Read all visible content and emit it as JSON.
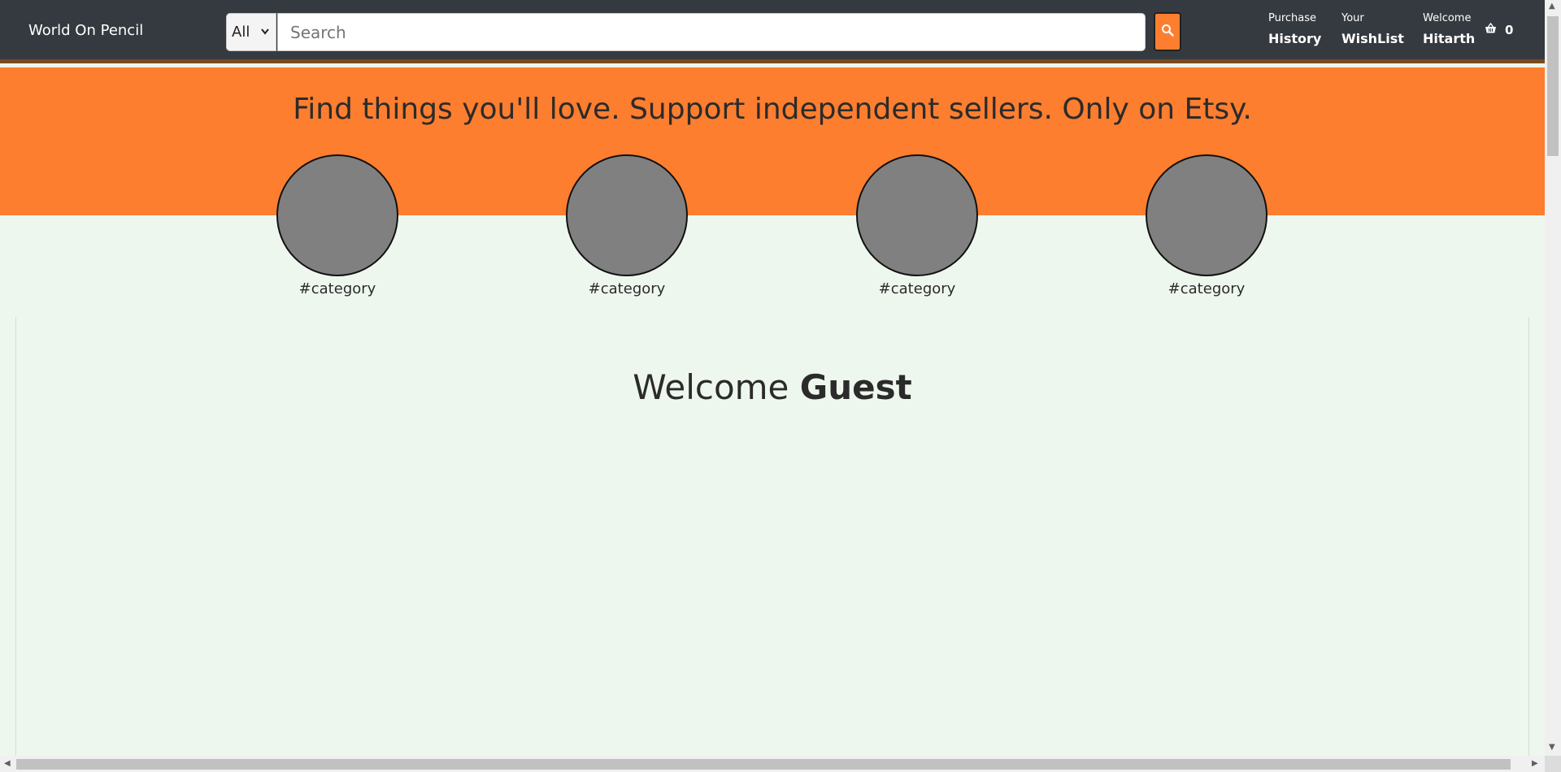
{
  "navbar": {
    "brand": "World On Pencil",
    "category_select": "All",
    "search_placeholder": "Search",
    "links": [
      {
        "small": "Purchase",
        "big": "History"
      },
      {
        "small": "Your",
        "big": "WishList"
      },
      {
        "small": "Welcome",
        "big": "Hitarth"
      }
    ],
    "cart_count": "0"
  },
  "hero": {
    "tagline": "Find things you'll love. Support independent sellers. Only on Etsy."
  },
  "categories": [
    {
      "label": "#category"
    },
    {
      "label": "#category"
    },
    {
      "label": "#category"
    },
    {
      "label": "#category"
    }
  ],
  "main": {
    "welcome_prefix": "Welcome",
    "welcome_name": "Guest"
  },
  "colors": {
    "navbar_bg": "#353a40",
    "accent": "#fd7e2f",
    "page_bg": "#eef7ee"
  },
  "icons": {
    "search_button": "search-icon",
    "cart": "basket-icon"
  }
}
